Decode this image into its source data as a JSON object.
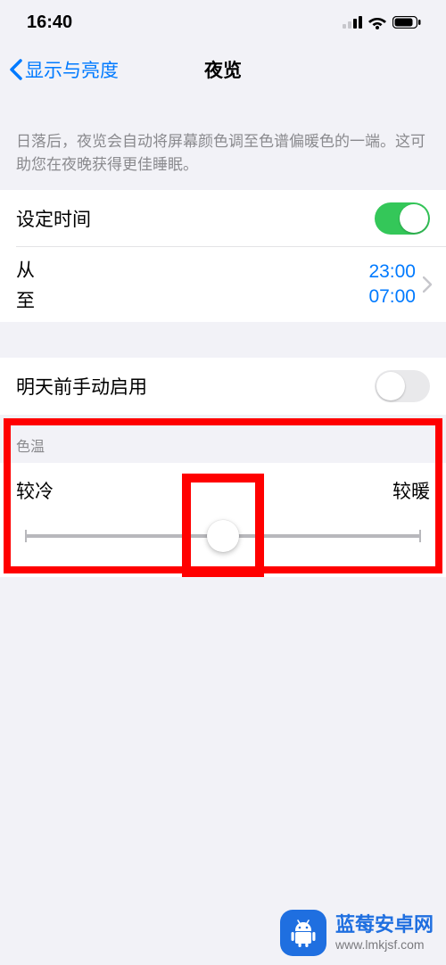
{
  "status": {
    "time": "16:40"
  },
  "nav": {
    "back_label": "显示与亮度",
    "title": "夜览"
  },
  "description": "日落后，夜览会自动将屏幕颜色调至色谱偏暖色的一端。这可助您在夜晚获得更佳睡眠。",
  "schedule": {
    "toggle_label": "设定时间",
    "toggle_on": true,
    "from_label": "从",
    "to_label": "至",
    "from_time": "23:00",
    "to_time": "07:00"
  },
  "manual": {
    "label": "明天前手动启用",
    "toggle_on": false
  },
  "color_temp": {
    "header": "色温",
    "cooler": "较冷",
    "warmer": "较暖",
    "position_percent": 50
  },
  "watermark": {
    "line1": "蓝莓安卓网",
    "line2": "www.lmkjsf.com"
  }
}
